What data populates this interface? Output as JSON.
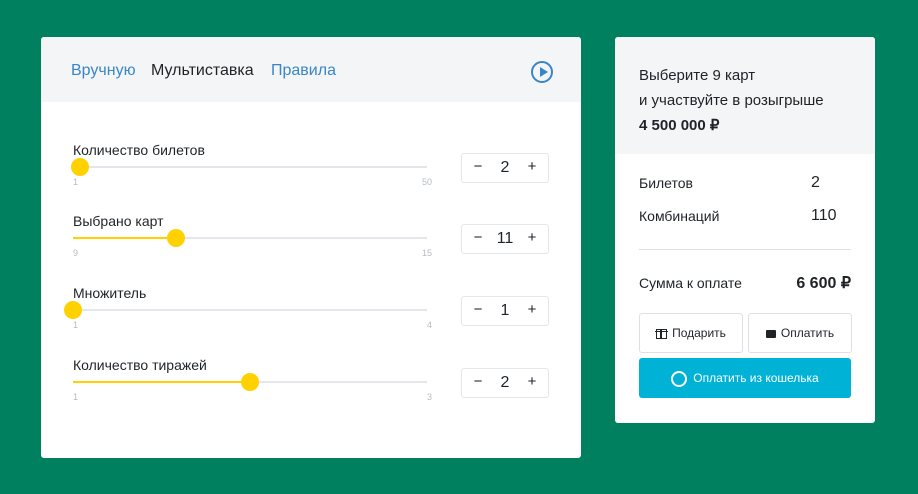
{
  "tabs": [
    {
      "label": "Вручную"
    },
    {
      "label": "Мультиставка"
    },
    {
      "label": "Правила"
    }
  ],
  "sliders": [
    {
      "label": "Количество билетов",
      "min": "1",
      "max": "50",
      "value": "2",
      "level": 0.02
    },
    {
      "label": "Выбрано карт",
      "min": "9",
      "max": "15",
      "value": "11",
      "level": 0.29
    },
    {
      "label": "Множитель",
      "min": "1",
      "max": "4",
      "value": "1",
      "level": 0.0
    },
    {
      "label": "Количество тиражей",
      "min": "1",
      "max": "3",
      "value": "2",
      "level": 0.5
    }
  ],
  "stepper": {
    "minus": "−",
    "plus": "+"
  },
  "promo": {
    "line1": "Выберите 9 карт",
    "line2": "и участвуйте в розыгрыше",
    "prize": "4 500 000 ₽"
  },
  "summary": {
    "tickets_label": "Билетов",
    "tickets_value": "2",
    "combos_label": "Комбинаций",
    "combos_value": "110",
    "total_label": "Сумма к оплате",
    "total_value": "6 600 ₽"
  },
  "actions": {
    "gift": "Подарить",
    "pay": "Оплатить",
    "wallet": "Оплатить из кошелька"
  },
  "colors": {
    "background": "#00805f",
    "accent": "#ffd100",
    "link": "#3a86c7",
    "wallet_button": "#00b2d6"
  }
}
